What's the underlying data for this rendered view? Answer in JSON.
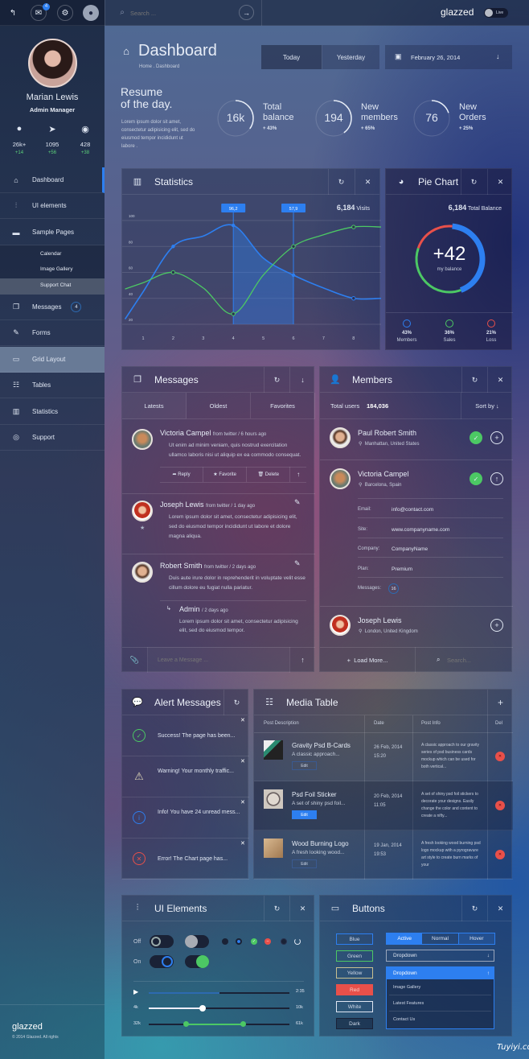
{
  "topbar": {
    "mail_badge": "4",
    "search_placeholder": "Search ...",
    "brand": "glazzed",
    "live_label": "Live"
  },
  "profile": {
    "name": "Marian Lewis",
    "role": "Admin Manager",
    "stats": [
      {
        "icon": "user-icon",
        "value": "26k+",
        "delta": "+14"
      },
      {
        "icon": "send-icon",
        "value": "1095",
        "delta": "+56"
      },
      {
        "icon": "eye-icon",
        "value": "428",
        "delta": "+38"
      }
    ]
  },
  "sidebar": {
    "items": [
      {
        "label": "Dashboard",
        "icon": "home-icon",
        "active": true
      },
      {
        "label": "UI elements",
        "icon": "sliders-icon"
      },
      {
        "label": "Sample Pages",
        "icon": "monitor-icon"
      },
      {
        "label": "Messages",
        "icon": "chat-icon",
        "badge": "4"
      },
      {
        "label": "Forms",
        "icon": "edit-icon"
      },
      {
        "label": "Grid Layout",
        "icon": "window-icon",
        "highlighted": true
      },
      {
        "label": "Tables",
        "icon": "table-icon"
      },
      {
        "label": "Statistics",
        "icon": "bar-chart-icon"
      },
      {
        "label": "Support",
        "icon": "lifebuoy-icon"
      }
    ],
    "subitems": [
      "Calendar",
      "Image Gallery",
      "Support Chat"
    ],
    "footer": {
      "brand": "glazzed",
      "copyright": "© 2014 Glazzed. All rights"
    }
  },
  "header": {
    "title": "Dashboard",
    "breadcrumb": "Home . Dashboard",
    "date_tabs": [
      "Today",
      "Yesterday"
    ],
    "date": "February 26, 2014"
  },
  "resume": {
    "title1": "Resume",
    "title2": "of the day.",
    "text": "Lorem ipsum dolor sit amet, consectetur adipisicing elit, sed do eiusmod tempor incididunt ut labore .",
    "kpis": [
      {
        "value": "16k",
        "label1": "Total",
        "label2": "balance",
        "delta": "+ 43%",
        "progress": 0.35
      },
      {
        "value": "194",
        "label1": "New",
        "label2": "members",
        "delta": "+ 65%",
        "progress": 0.4
      },
      {
        "value": "76",
        "label1": "New",
        "label2": "Orders",
        "delta": "+ 25%",
        "progress": 0.2
      }
    ]
  },
  "statistics": {
    "title": "Statistics",
    "visits_value": "6,184",
    "visits_label": "Visits"
  },
  "chart_data": {
    "type": "line",
    "x": [
      1,
      2,
      3,
      4,
      5,
      6,
      7,
      8
    ],
    "yticks": [
      20,
      40,
      60,
      80,
      100
    ],
    "ylim": [
      20,
      100
    ],
    "grid": true,
    "series": [
      {
        "color": "#2d7ff0",
        "values": [
          45,
          80,
          88,
          96.2,
          71,
          57.9,
          48,
          40
        ]
      },
      {
        "color": "#4cc864",
        "values": [
          52,
          60,
          48,
          28,
          58,
          80,
          89,
          95
        ]
      }
    ],
    "annotations": [
      "96,2",
      "57,9"
    ]
  },
  "pie": {
    "title": "Pie Chart",
    "total_value": "6,184",
    "total_label": "Total Balance",
    "center_value": "+42",
    "center_label": "my balance",
    "slices": [
      {
        "label": "Members",
        "pct": "43%",
        "value": 43,
        "color": "#2d7ff0"
      },
      {
        "label": "Sales",
        "pct": "36%",
        "value": 36,
        "color": "#4cc864"
      },
      {
        "label": "Loss",
        "pct": "21%",
        "value": 21,
        "color": "#e8504a"
      }
    ]
  },
  "messages": {
    "title": "Messages",
    "tabs": [
      "Latests",
      "Oldest",
      "Favorites"
    ],
    "items": [
      {
        "name": "Victoria Campel",
        "meta": "from twitter  /  6 hours ago",
        "text": "Ut enim ad minim veniam, quis nostrud exercitation ullamco laboris nisi ut aliquip ex ea commodo consequat."
      },
      {
        "name": "Joseph Lewis",
        "meta": "from twitter  /  1 day ago",
        "text": "Lorem ipsum dolor sit amet, consectetur adipisicing elit, sed do eiusmod tempor incididunt ut labore et dolore magna aliqua."
      },
      {
        "name": "Robert Smith",
        "meta": "from twitter  /  2 days ago",
        "text": "Duis aute irure dolor in reprehenderit in voluptate velit esse cillum dolore eu fugiat nulla pariatur."
      }
    ],
    "actions": [
      "Reply",
      "Favorite",
      "Delete"
    ],
    "reply": {
      "name": "Admin",
      "meta": "/ 2 days ago",
      "text": "Lorem ipsum dolor sit amet, consectetur adipisicing elit, sed do eiusmod tempor."
    },
    "input_placeholder": "Leave a Message ..."
  },
  "members": {
    "title": "Members",
    "total_label": "Total users",
    "total_value": "184,036",
    "sort_label": "Sort by",
    "items": [
      {
        "name": "Paul Robert Smith",
        "location": "Manhattan, United States"
      },
      {
        "name": "Victoria Campel",
        "location": "Barcelona, Spain"
      },
      {
        "name": "Joseph Lewis",
        "location": "London, United Kingdom"
      }
    ],
    "details": [
      {
        "label": "Email:",
        "value": "info@contact.com"
      },
      {
        "label": "Site:",
        "value": "www.companyname.com"
      },
      {
        "label": "Company:",
        "value": "CompanyName"
      },
      {
        "label": "Plan:",
        "value": "Premium"
      },
      {
        "label": "Messages:",
        "value": "16"
      }
    ],
    "load_more": "Load More...",
    "search_placeholder": "Search..."
  },
  "alerts": {
    "title": "Alert Messages",
    "items": [
      {
        "type": "success",
        "text": "Success! The page has been..."
      },
      {
        "type": "warning",
        "text": "Warning! Your monthly traffic..."
      },
      {
        "type": "info",
        "text": "Info! You have 24 unread mess..."
      },
      {
        "type": "error",
        "text": "Error! The Chart page has..."
      }
    ]
  },
  "media": {
    "title": "Media Table",
    "columns": [
      "Post Description",
      "Date",
      "Post Info",
      "Del"
    ],
    "rows": [
      {
        "title": "Gravity Psd B-Cards",
        "sub": "A classic approach...",
        "date": "26 Feb, 2014",
        "time": "15:20",
        "info": "A classic approach to our gravity series of psd business cards mockup which can be used for both vertical...",
        "edit": "Edit"
      },
      {
        "title": "Psd Foil Sticker",
        "sub": "A set of shiny psd foil...",
        "date": "20 Feb, 2014",
        "time": "11:05",
        "info": "A set of shiny psd foil stickers to decorate your designs. Easily change the color and content to create a nifty...",
        "edit": "Edit"
      },
      {
        "title": "Wood Burning Logo",
        "sub": "A fresh looking wood...",
        "date": "19 Jan, 2014",
        "time": "19:53",
        "info": "A fresh looking wood burning psd logo mockup with a pyrogravure art style to create burn marks of your",
        "edit": "Edit"
      }
    ]
  },
  "ui_elements": {
    "title": "UI Elements",
    "off_label": "Off",
    "on_label": "On",
    "player_time": "2:35",
    "player_progress": 0.5,
    "slider1": {
      "min": "4k",
      "max": "10k",
      "value": 0.38
    },
    "slider2": {
      "min": "32k",
      "max": "61k",
      "low": 0.26,
      "high": 0.67
    }
  },
  "buttons": {
    "title": "Buttons",
    "list": [
      {
        "label": "Blue",
        "color": "#2d7ff0"
      },
      {
        "label": "Green",
        "color": "#4cc864"
      },
      {
        "label": "Yellow",
        "color": "#c8c090"
      },
      {
        "label": "Red",
        "color": "#e8504a"
      },
      {
        "label": "White",
        "color": "#dfe6f2"
      },
      {
        "label": "Dark",
        "color": "#1a2238"
      }
    ],
    "segments": [
      "Active",
      "Normal",
      "Hover"
    ],
    "dropdown": "Dropdown",
    "dropdown_open": "Dropdown",
    "dropdown_items": [
      "Image Gallery",
      "Latest Features",
      "Contact Us"
    ]
  },
  "watermark": "Tuyiyi.com"
}
